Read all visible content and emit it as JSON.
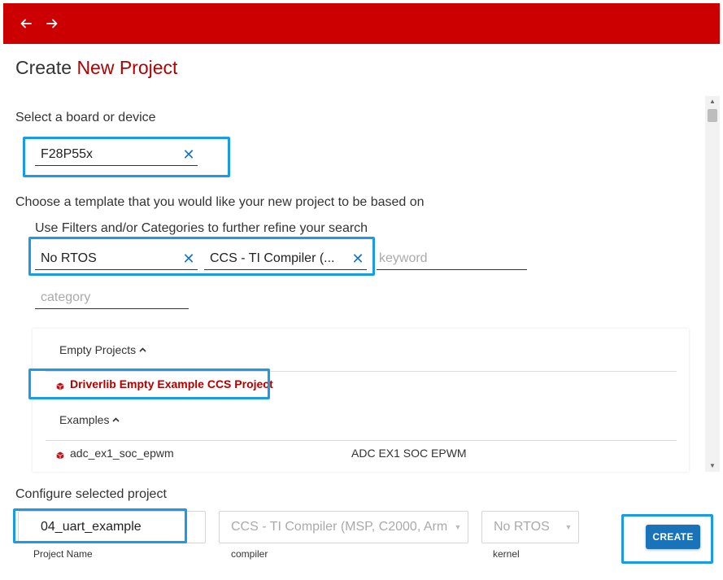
{
  "nav": {
    "back_icon": "arrow-left-icon",
    "forward_icon": "arrow-right-icon",
    "bar_color": "#cc0000"
  },
  "header": {
    "title_prefix": "Create",
    "title_accent": "New Project",
    "accent_color": "#b30000"
  },
  "board": {
    "label": "Select a board or device",
    "value": "F28P55x"
  },
  "template": {
    "label": "Choose a template that you would like your new project to be based on",
    "filters_label": "Use Filters and/or Categories to further refine your search",
    "rtos_filter": "No RTOS",
    "compiler_filter": "CCS - TI Compiler (...",
    "keyword_placeholder": "keyword",
    "category_placeholder": "category"
  },
  "tree": {
    "empty_projects_header": "Empty Projects",
    "empty_projects": [
      {
        "name": "Driverlib Empty Example CCS Project"
      }
    ],
    "examples_header": "Examples",
    "examples": [
      {
        "name": "adc_ex1_soc_epwm",
        "description": "ADC EX1 SOC EPWM"
      }
    ]
  },
  "configure": {
    "label": "Configure selected project",
    "project_name": "04_uart_example",
    "project_name_label": "Project Name",
    "compiler_value": "CCS - TI Compiler (MSP, C2000, Arm)",
    "compiler_label": "compiler",
    "kernel_value": "No RTOS",
    "kernel_label": "kernel",
    "create_label": "CREATE",
    "button_color": "#1a73b8"
  },
  "highlight_color": "#1a9be6"
}
